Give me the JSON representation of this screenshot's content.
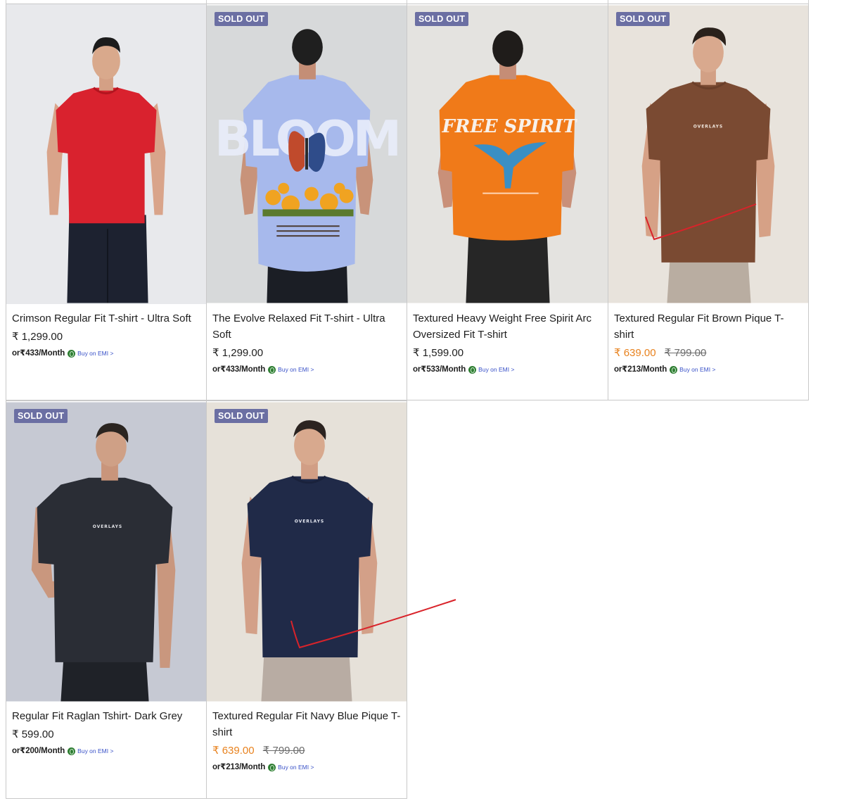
{
  "colors": {
    "badge_bg": "#6b6fa3",
    "sale_price": "#e8821e",
    "emi_link": "#3a52c8",
    "annotation_stroke": "#d9232a"
  },
  "products": [
    {
      "title": "Crimson Regular Fit T-shirt - Ultra Soft",
      "price": "₹ 1,299.00",
      "emi": "or₹433/Month",
      "emi_link": "Buy on EMI >",
      "image_icon": "red-tshirt-model-front-image"
    },
    {
      "badge": "SOLD OUT",
      "title": "The Evolve Relaxed Fit T-shirt - Ultra Soft",
      "price": "₹ 1,299.00",
      "emi": "or₹433/Month",
      "emi_link": "Buy on EMI >",
      "image_icon": "blue-bloom-print-tshirt-back-image"
    },
    {
      "badge": "SOLD OUT",
      "title": "Textured Heavy Weight Free Spirit Arc Oversized Fit T-shirt",
      "price": "₹ 1,599.00",
      "emi": "or₹533/Month",
      "emi_link": "Buy on EMI >",
      "image_icon": "orange-free-spirit-tshirt-back-image"
    },
    {
      "badge": "SOLD OUT",
      "title": "Textured Regular Fit Brown Pique T-shirt",
      "sale_price": "₹ 639.00",
      "compare_price": "₹ 799.00",
      "emi": "or₹213/Month",
      "emi_link": "Buy on EMI >",
      "image_icon": "brown-tshirt-model-front-image"
    },
    {
      "badge": "SOLD OUT",
      "title": "Regular Fit Raglan Tshirt- Dark Grey",
      "price": "₹ 599.00",
      "emi": "or₹200/Month",
      "emi_link": "Buy on EMI >",
      "image_icon": "dark-grey-raglan-tshirt-model-image"
    },
    {
      "badge": "SOLD OUT",
      "title": "Textured Regular Fit Navy Blue Pique T-shirt",
      "sale_price": "₹ 639.00",
      "compare_price": "₹ 799.00",
      "emi": "or₹213/Month",
      "emi_link": "Buy on EMI >",
      "image_icon": "navy-tshirt-model-front-image"
    }
  ],
  "shirt_print": {
    "bloom": "BLOOM",
    "free_spirit": "FREE SPIRIT",
    "overlays": "OVERLAYS"
  }
}
